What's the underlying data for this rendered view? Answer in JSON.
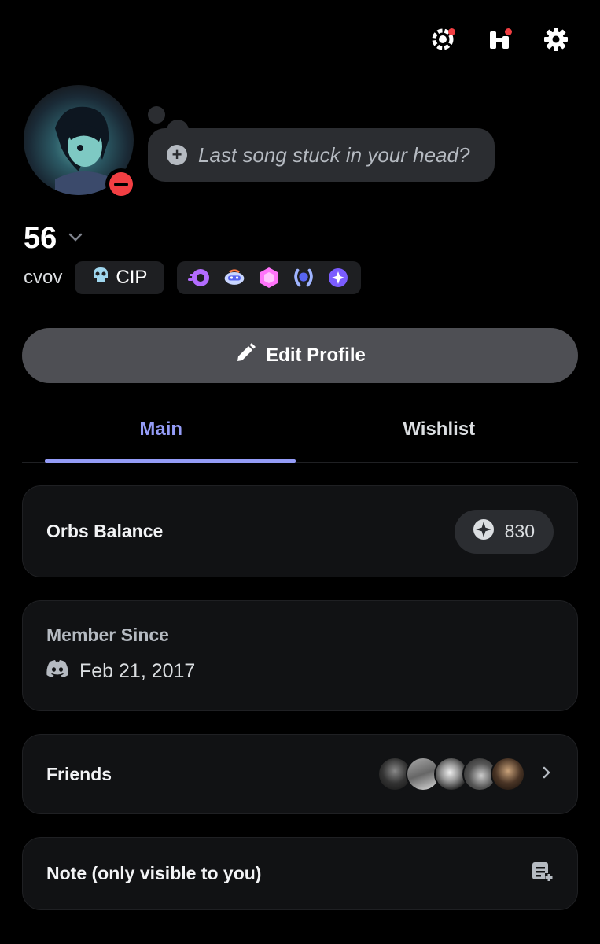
{
  "header": {
    "icons": [
      "nitro-icon",
      "shop-icon",
      "settings-icon"
    ],
    "notification_color": "#f23f43"
  },
  "profile": {
    "status_prompt": "Last song stuck in your head?",
    "display_name": "56",
    "username": "cvov",
    "clan_tag": "CIP",
    "status_indicator": "do-not-disturb",
    "badges": [
      "nitro-badge",
      "quest-badge",
      "boost-badge",
      "laurel-badge",
      "orb-badge"
    ]
  },
  "actions": {
    "edit_profile_label": "Edit Profile"
  },
  "tabs": [
    {
      "label": "Main",
      "active": true
    },
    {
      "label": "Wishlist",
      "active": false
    }
  ],
  "orbs": {
    "title": "Orbs Balance",
    "value": "830"
  },
  "member_since": {
    "label": "Member Since",
    "date": "Feb 21, 2017"
  },
  "friends": {
    "title": "Friends"
  },
  "note": {
    "title": "Note (only visible to you)"
  },
  "colors": {
    "accent": "#949cf7",
    "background": "#000000",
    "card": "#111214",
    "button": "#4e4f54",
    "dnd": "#f23f43"
  }
}
